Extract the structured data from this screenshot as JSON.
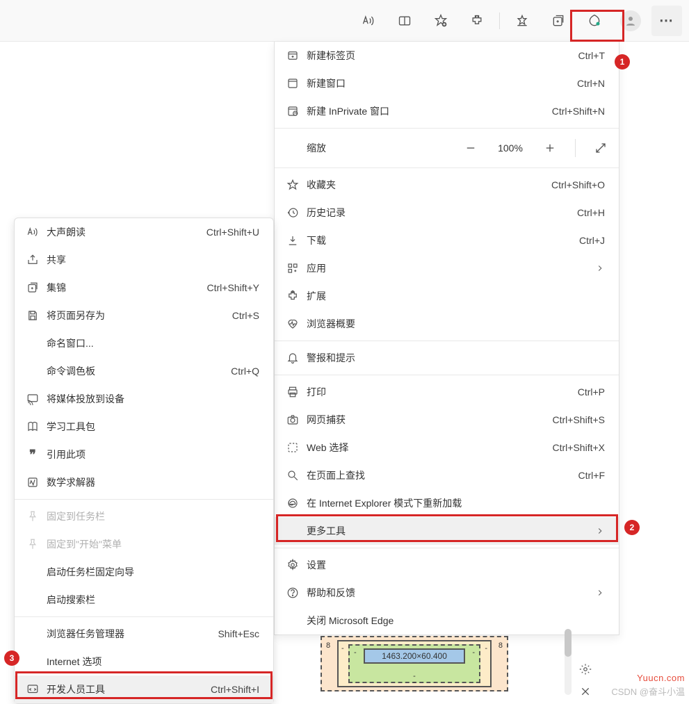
{
  "toolbar": {
    "read_aloud": "read-aloud-icon",
    "split_screen": "split-screen-icon",
    "favorite": "favorite-add-icon",
    "extensions": "extensions-icon",
    "favorites_list": "favorites-icon",
    "collections": "collections-icon",
    "performance": "performance-icon",
    "profile": "profile-avatar",
    "more": "⋯"
  },
  "menu": {
    "new_tab": {
      "label": "新建标签页",
      "shortcut": "Ctrl+T"
    },
    "new_window": {
      "label": "新建窗口",
      "shortcut": "Ctrl+N"
    },
    "new_inprivate": {
      "label": "新建 InPrivate 窗口",
      "shortcut": "Ctrl+Shift+N"
    },
    "zoom": {
      "label": "缩放",
      "value": "100%"
    },
    "favorites": {
      "label": "收藏夹",
      "shortcut": "Ctrl+Shift+O"
    },
    "history": {
      "label": "历史记录",
      "shortcut": "Ctrl+H"
    },
    "downloads": {
      "label": "下载",
      "shortcut": "Ctrl+J"
    },
    "apps": {
      "label": "应用"
    },
    "extensions": {
      "label": "扩展"
    },
    "browser_essentials": {
      "label": "浏览器概要"
    },
    "alerts": {
      "label": "警报和提示"
    },
    "print": {
      "label": "打印",
      "shortcut": "Ctrl+P"
    },
    "web_capture": {
      "label": "网页捕获",
      "shortcut": "Ctrl+Shift+S"
    },
    "web_select": {
      "label": "Web 选择",
      "shortcut": "Ctrl+Shift+X"
    },
    "find": {
      "label": "在页面上查找",
      "shortcut": "Ctrl+F"
    },
    "ie_mode": {
      "label": "在 Internet Explorer 模式下重新加载"
    },
    "more_tools": {
      "label": "更多工具"
    },
    "settings": {
      "label": "设置"
    },
    "help": {
      "label": "帮助和反馈"
    },
    "close": {
      "label": "关闭 Microsoft Edge"
    }
  },
  "submenu": {
    "read_aloud": {
      "label": "大声朗读",
      "shortcut": "Ctrl+Shift+U"
    },
    "share": {
      "label": "共享"
    },
    "collections": {
      "label": "集锦",
      "shortcut": "Ctrl+Shift+Y"
    },
    "save_as": {
      "label": "将页面另存为",
      "shortcut": "Ctrl+S"
    },
    "name_window": {
      "label": "命名窗口..."
    },
    "command_palette": {
      "label": "命令调色板",
      "shortcut": "Ctrl+Q"
    },
    "cast": {
      "label": "将媒体投放到设备"
    },
    "learning_tools": {
      "label": "学习工具包"
    },
    "cite": {
      "label": "引用此项"
    },
    "math_solver": {
      "label": "数学求解器"
    },
    "pin_taskbar": {
      "label": "固定到任务栏"
    },
    "pin_start": {
      "label": "固定到\"开始\"菜单"
    },
    "taskbar_wizard": {
      "label": "启动任务栏固定向导"
    },
    "search_bar": {
      "label": "启动搜索栏"
    },
    "task_manager": {
      "label": "浏览器任务管理器",
      "shortcut": "Shift+Esc"
    },
    "ie_options": {
      "label": "Internet 选项"
    },
    "dev_tools": {
      "label": "开发人员工具",
      "shortcut": "Ctrl+Shift+I"
    }
  },
  "annotations": {
    "a1": "1",
    "a2": "2",
    "a3": "3"
  },
  "devtools": {
    "content_size": "1463.200×60.400",
    "margin": "8",
    "dash": "-"
  },
  "watermark": {
    "line1": "Yuucn.com",
    "line2": "CSDN @奋斗小温"
  }
}
